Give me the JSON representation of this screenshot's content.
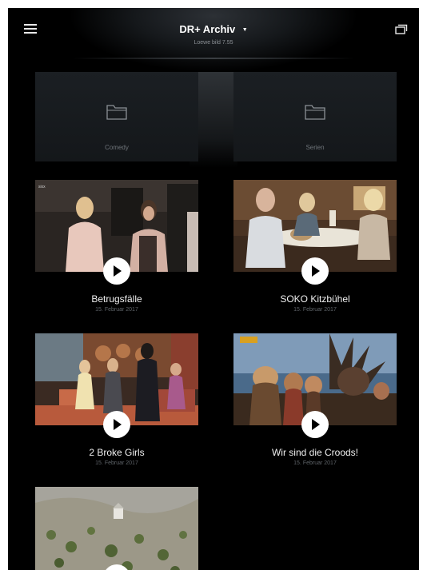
{
  "header": {
    "title": "DR+ Archiv",
    "subtitle": "Loewe bild 7.55"
  },
  "folders": [
    {
      "label": "Comedy"
    },
    {
      "label": "Serien"
    }
  ],
  "videos": [
    {
      "title": "Betrugsfälle",
      "date": "15. Februar 2017"
    },
    {
      "title": "SOKO Kitzbühel",
      "date": "15. Februar 2017"
    },
    {
      "title": "2 Broke Girls",
      "date": "15. Februar 2017"
    },
    {
      "title": "Wir sind die Croods!",
      "date": "15. Februar 2017"
    },
    {
      "title": "",
      "date": ""
    }
  ],
  "colors": {
    "background": "#000000",
    "folder_tile": "#1b1f23",
    "text_primary": "#f0f0f0",
    "text_secondary": "#5f6469"
  },
  "icons": {
    "menu": "hamburger-menu-icon",
    "dropdown": "caret-down-icon",
    "screens": "screens-icon",
    "folder": "folder-icon",
    "play": "play-icon"
  }
}
